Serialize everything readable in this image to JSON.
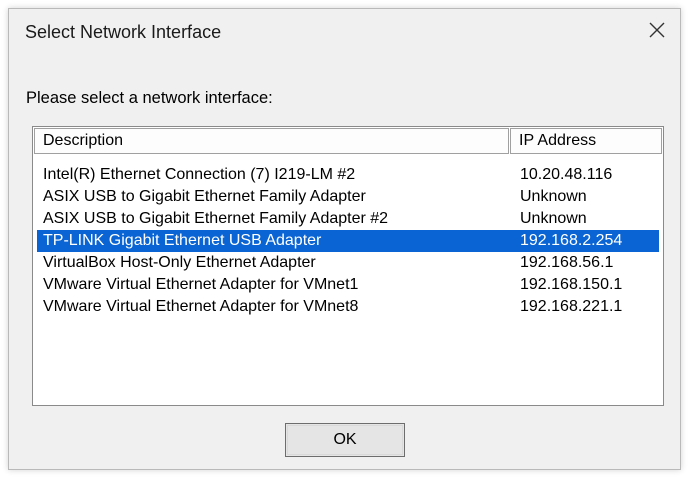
{
  "dialog": {
    "title": "Select Network Interface",
    "prompt": "Please select a network interface:",
    "ok_label": "OK"
  },
  "listview": {
    "columns": [
      "Description",
      "IP Address"
    ],
    "rows": [
      {
        "description": "Intel(R) Ethernet Connection (7) I219-LM #2",
        "ip": "10.20.48.116",
        "selected": false
      },
      {
        "description": "ASIX USB to Gigabit Ethernet Family Adapter",
        "ip": "Unknown",
        "selected": false
      },
      {
        "description": "ASIX USB to Gigabit Ethernet Family Adapter #2",
        "ip": "Unknown",
        "selected": false
      },
      {
        "description": "TP-LINK Gigabit Ethernet USB Adapter",
        "ip": "192.168.2.254",
        "selected": true
      },
      {
        "description": "VirtualBox Host-Only Ethernet Adapter",
        "ip": "192.168.56.1",
        "selected": false
      },
      {
        "description": "VMware Virtual Ethernet Adapter for VMnet1",
        "ip": "192.168.150.1",
        "selected": false
      },
      {
        "description": "VMware Virtual Ethernet Adapter for VMnet8",
        "ip": "192.168.221.1",
        "selected": false
      }
    ]
  },
  "colors": {
    "selection": "#0a64d3",
    "dialog_bg": "#f0f0f0"
  },
  "icons": {
    "close": "close-icon"
  }
}
